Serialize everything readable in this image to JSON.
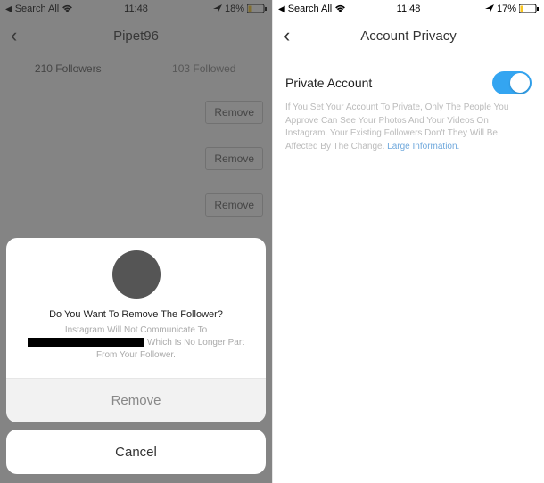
{
  "left": {
    "status": {
      "carrier": "Search All",
      "time": "11:48",
      "battery": "18%"
    },
    "nav": {
      "title": "Pipet96"
    },
    "tabs": {
      "followers": "210 Followers",
      "followed": "103 Followed"
    },
    "removeLabel": "Remove",
    "sheet": {
      "prompt": "Do You Want To Remove The Follower?",
      "sub1": "Instagram Will Not Communicate To",
      "sub2": "Which Is No Longer Part From Your Follower.",
      "remove": "Remove",
      "cancel": "Cancel"
    }
  },
  "right": {
    "status": {
      "carrier": "Search All",
      "time": "11:48",
      "battery": "17%"
    },
    "nav": {
      "title": "Account Privacy"
    },
    "privateLabel": "Private Account",
    "desc": "If You Set Your Account To Private, Only The People You Approve Can See Your Photos And Your Videos On Instagram. Your Existing Followers Don't They Will Be Affected By The Change.",
    "descLink": "Large Information."
  }
}
